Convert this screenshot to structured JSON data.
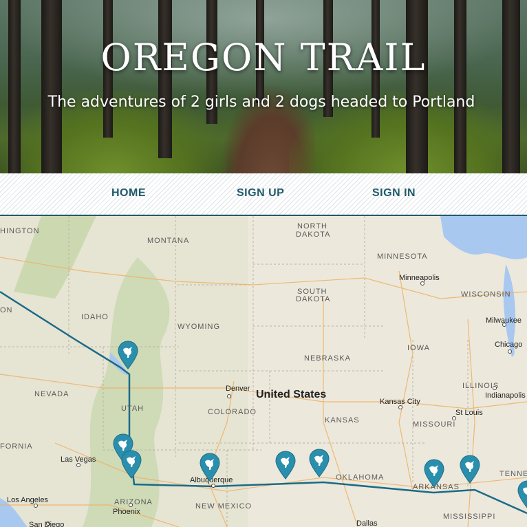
{
  "header": {
    "title": "OREGON TRAIL",
    "tagline": "The adventures of 2 girls and 2 dogs headed to Portland"
  },
  "nav": {
    "home": "HOME",
    "sign_up": "SIGN UP",
    "sign_in": "SIGN IN"
  },
  "map": {
    "country": "United States",
    "states": [
      "HINGTON",
      "MONTANA",
      "NORTH",
      "DAKOTA",
      "MINNESOTA",
      "SOUTH",
      "DAKOTA",
      "WISCONSIN",
      "IDAHO",
      "WYOMING",
      "ON",
      "IOWA",
      "NEBRASKA",
      "NEVADA",
      "UTAH",
      "COLORADO",
      "KANSAS",
      "MISSOURI",
      "ILLINOIS",
      "FORNIA",
      "OKLAHOMA",
      "ARKANSAS",
      "ARIZONA",
      "NEW MEXICO",
      "MISSISSIPPI",
      "TENNE"
    ],
    "cities": [
      "Minneapolis",
      "Milwaukee",
      "Chicago",
      "Indianapolis",
      "Denver",
      "Kansas City",
      "St Louis",
      "Las Vegas",
      "Albuquerque",
      "Los Angeles",
      "Phoenix",
      "San Diego",
      "Dallas"
    ],
    "marker_icon": "bird-pin-icon",
    "marker_color": "#2a8fad",
    "route_color": "#1a6a88",
    "water_color": "#a8c8f0"
  }
}
